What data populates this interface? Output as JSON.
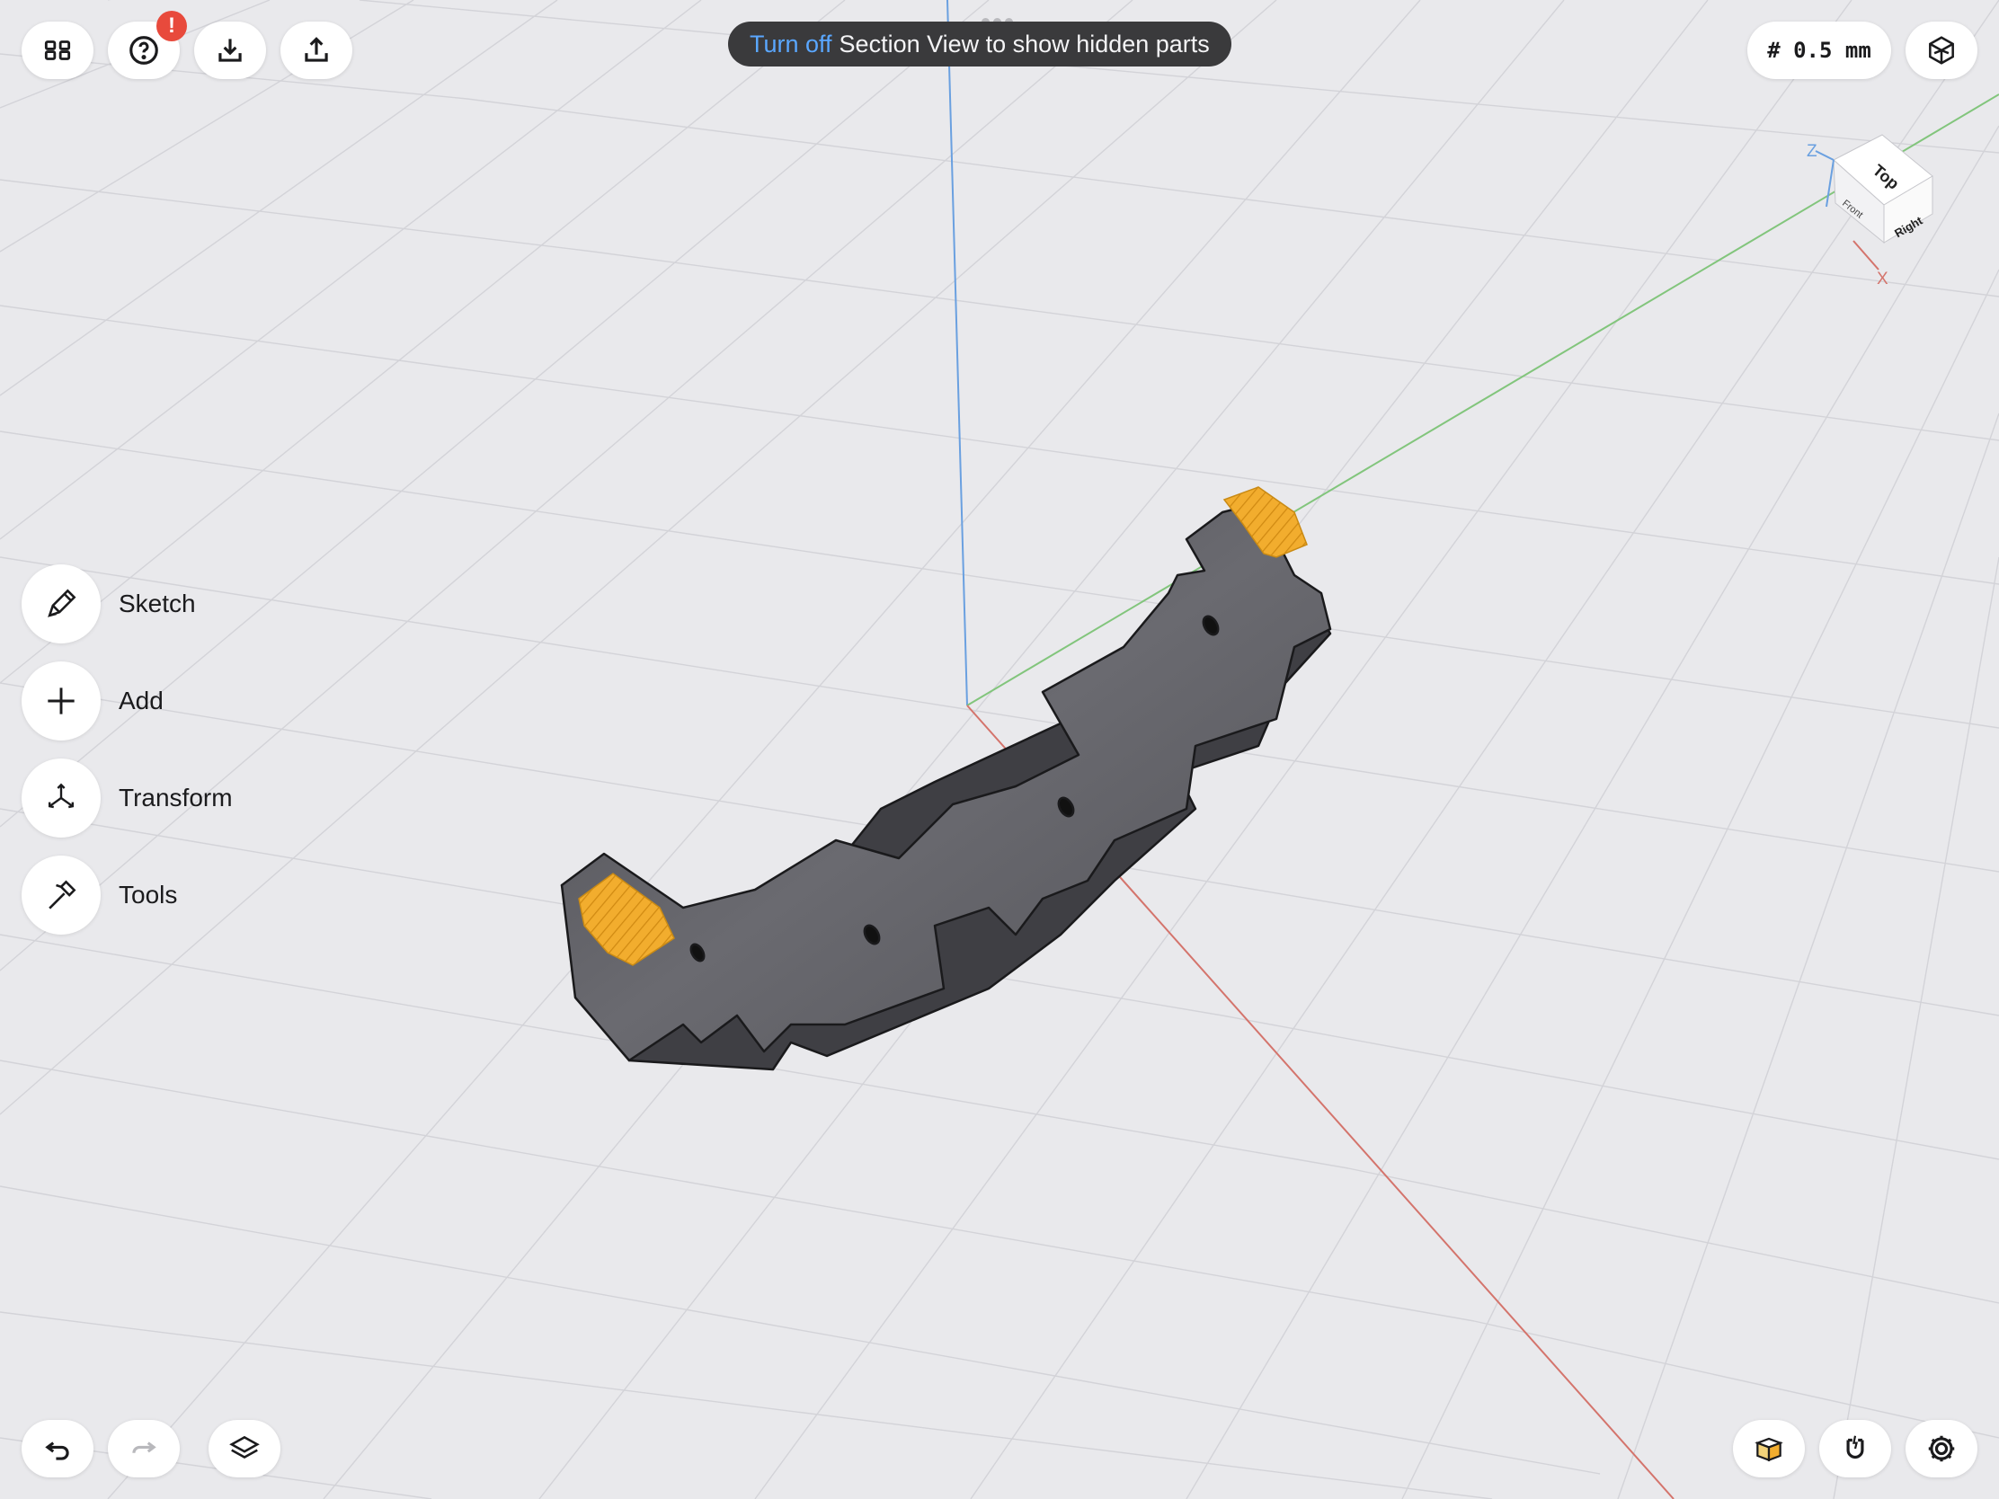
{
  "banner": {
    "action": "Turn off",
    "message": "Section View to show hidden parts"
  },
  "toolbar": {
    "notification_badge": "!",
    "grid_size": "# 0.5 mm"
  },
  "tools": [
    {
      "label": "Sketch",
      "icon": "pencil-icon"
    },
    {
      "label": "Add",
      "icon": "plus-icon"
    },
    {
      "label": "Transform",
      "icon": "transform-arrows-icon"
    },
    {
      "label": "Tools",
      "icon": "hammer-icon"
    }
  ],
  "view_cube": {
    "top": "Top",
    "right": "Right",
    "front": "Front",
    "axis_z": "Z",
    "axis_x": "X"
  },
  "colors": {
    "background": "#e9e9ec",
    "grid": "#d3d3d8",
    "axis_x": "#d4746c",
    "axis_y": "#82c57c",
    "axis_z": "#6aa0e0",
    "part_body": "#5b5b60",
    "section_face": "#f2ad2e",
    "banner_accent": "#5aa7ff",
    "badge": "#e84a3c"
  }
}
